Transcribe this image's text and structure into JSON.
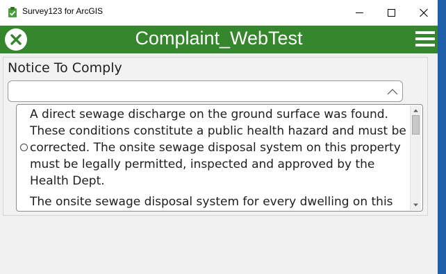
{
  "window": {
    "title": "Survey123 for ArcGIS",
    "controls": [
      "minimize",
      "maximize",
      "close"
    ]
  },
  "appbar": {
    "title": "Complaint_WebTest",
    "colors": {
      "accent": "#35862d"
    }
  },
  "question": {
    "label": "Notice To Comply",
    "combo_value": "",
    "option_1_text": "A direct sewage discharge on the ground surface was found. These conditions constitute a public health hazard and must be corrected. The onsite sewage disposal system on this property must be legally permitted, inspected and approved by the Health Dept.",
    "option_2_text": "The onsite sewage disposal system for every dwelling on this"
  },
  "icons": {
    "app": "survey123-icon",
    "close_form": "close-icon",
    "menu": "hamburger-menu-icon",
    "combo": "chevron-up-icon"
  }
}
